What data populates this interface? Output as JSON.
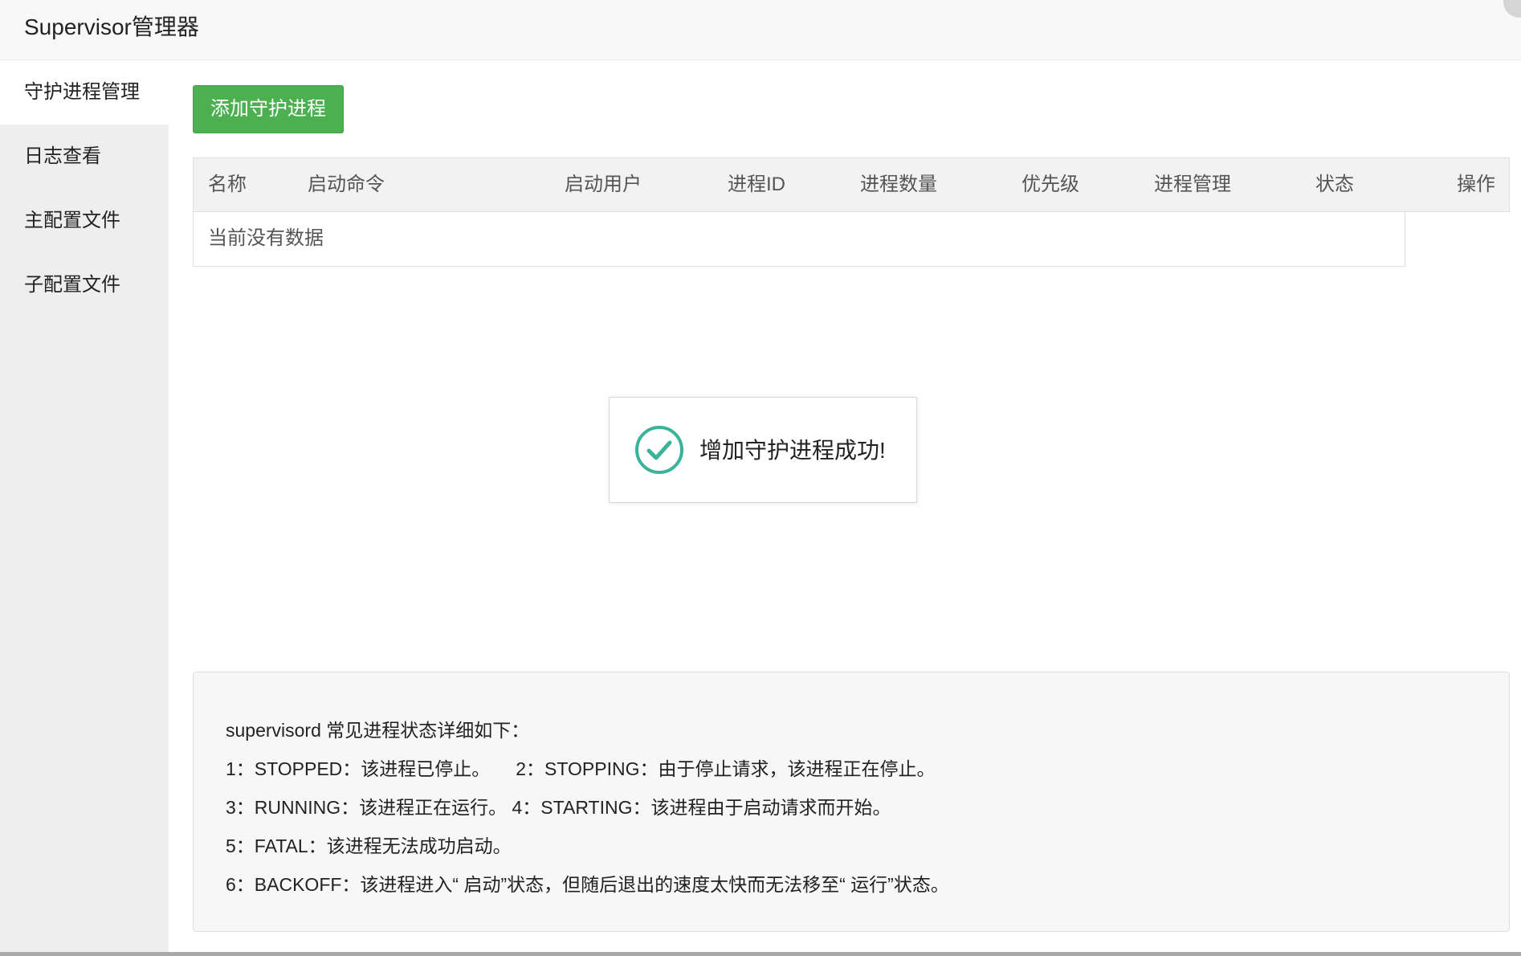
{
  "app": {
    "title": "Supervisor管理器"
  },
  "sidebar": {
    "items": [
      {
        "label": "守护进程管理"
      },
      {
        "label": "日志查看"
      },
      {
        "label": "主配置文件"
      },
      {
        "label": "子配置文件"
      }
    ]
  },
  "toolbar": {
    "add_label": "添加守护进程"
  },
  "table": {
    "columns": [
      "名称",
      "启动命令",
      "启动用户",
      "进程ID",
      "进程数量",
      "优先级",
      "进程管理",
      "状态",
      "操作"
    ],
    "empty_text": "当前没有数据"
  },
  "toast": {
    "message": "增加守护进程成功!",
    "icon": "check-circle-icon"
  },
  "info": {
    "lines": [
      "supervisord 常见进程状态详细如下：",
      "1：STOPPED：该进程已停止。     2：STOPPING：由于停止请求，该进程正在停止。",
      "3：RUNNING：该进程正在运行。 4：STARTING：该进程由于启动请求而开始。",
      "5：FATAL：该进程无法成功启动。",
      "6：BACKOFF：该进程进入“ 启动”状态，但随后退出的速度太快而无法移至“ 运行”状态。"
    ]
  },
  "colors": {
    "primary_button": "#4caf50",
    "sidebar_bg": "#eeeeee",
    "check_icon": "#3bb39a"
  }
}
